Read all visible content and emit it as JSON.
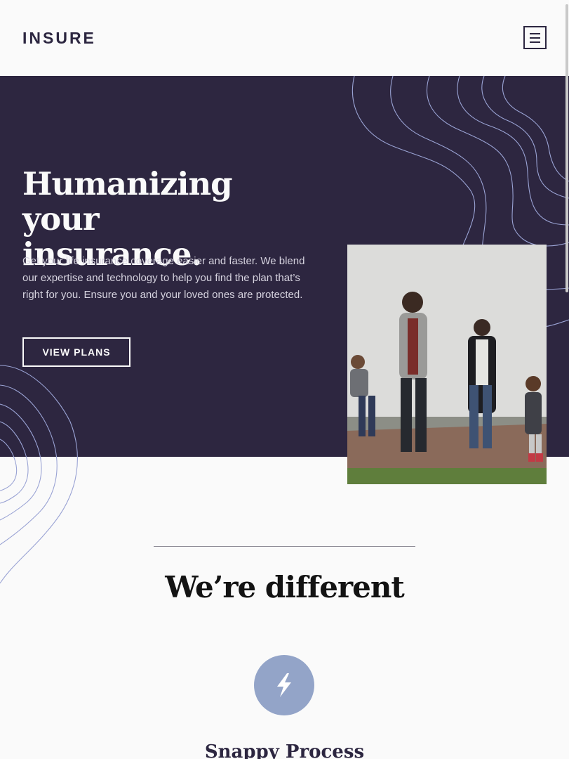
{
  "header": {
    "logo": "INSURE",
    "menu_icon": "hamburger-menu-icon"
  },
  "hero": {
    "title_line1": "Humanizing your",
    "title_line2": "insurance.",
    "description": "Get your life insurance coverage easier and faster. We blend our expertise and technology to help you find the plan that’s right for you. Ensure you and your loved ones are protected.",
    "button_label": "VIEW PLANS"
  },
  "features": {
    "section_title": "We’re different",
    "items": [
      {
        "icon": "lightning-bolt-icon",
        "title": "Snappy Process"
      }
    ]
  },
  "colors": {
    "hero_bg": "#2d2640",
    "page_bg": "#fafafa",
    "curve_stroke": "#9aa3d4",
    "icon_circle": "#93a4c8",
    "text_dark": "#131313"
  }
}
